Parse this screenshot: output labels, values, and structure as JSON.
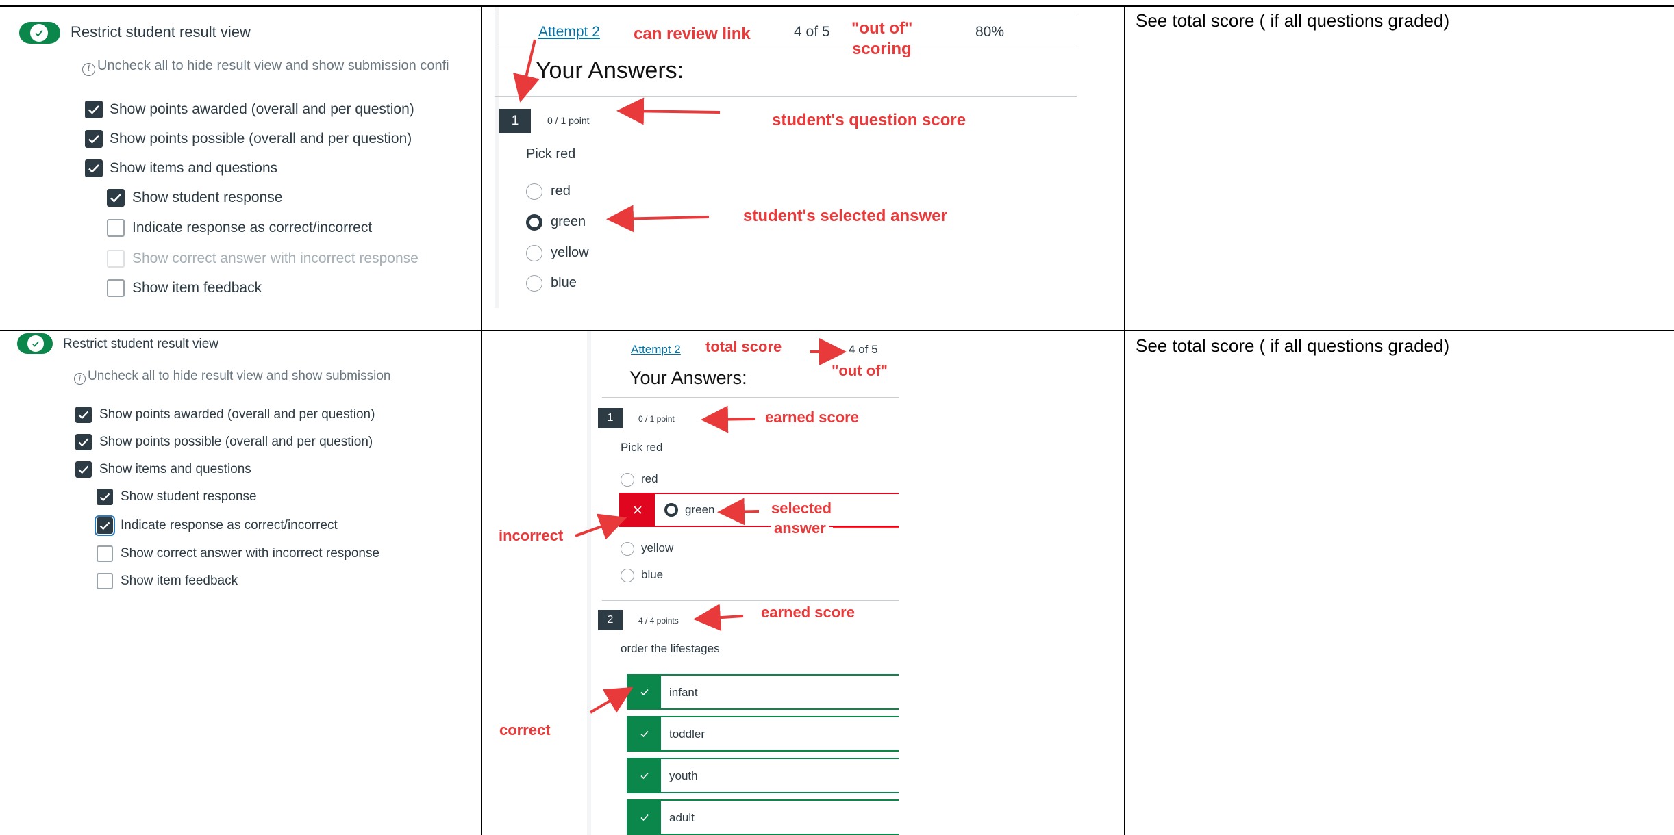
{
  "rows": [
    {
      "settings": {
        "toggle_label": "Restrict student result view",
        "hint": "Uncheck all to hide result view and show submission confi",
        "options": [
          {
            "label": "Show points awarded (overall and per question)",
            "checked": true
          },
          {
            "label": "Show points possible (overall and per question)",
            "checked": true
          },
          {
            "label": "Show items and questions",
            "checked": true
          },
          {
            "label": "Show student response",
            "checked": true
          },
          {
            "label": "Indicate response as correct/incorrect",
            "checked": false
          },
          {
            "label": "Show correct answer with incorrect response",
            "checked": false,
            "disabled": true
          },
          {
            "label": "Show item feedback",
            "checked": false
          }
        ]
      },
      "preview": {
        "attempt_link": "Attempt 2",
        "score": "4 of 5",
        "percent": "80%",
        "heading": "Your Answers:",
        "question": {
          "number": "1",
          "points": "0 / 1 point",
          "prompt": "Pick red",
          "choices": [
            "red",
            "green",
            "yellow",
            "blue"
          ],
          "selected": "green"
        },
        "annotations": {
          "review_link": "can review link",
          "out_of_line1": "\"out of\"",
          "out_of_line2": "scoring",
          "question_score": "student's question score",
          "selected_answer": "student's selected answer"
        }
      },
      "note": "See total score ( if all questions graded)"
    },
    {
      "settings": {
        "toggle_label": "Restrict student result view",
        "hint": "Uncheck all to hide result view and show submission",
        "options": [
          {
            "label": "Show points awarded (overall and per question)",
            "checked": true
          },
          {
            "label": "Show points possible (overall and per question)",
            "checked": true
          },
          {
            "label": "Show items and questions",
            "checked": true
          },
          {
            "label": "Show student response",
            "checked": true
          },
          {
            "label": "Indicate response as correct/incorrect",
            "checked": true,
            "focused": true
          },
          {
            "label": "Show correct answer with incorrect response",
            "checked": false
          },
          {
            "label": "Show item feedback",
            "checked": false
          }
        ]
      },
      "preview": {
        "attempt_link": "Attempt 2",
        "score": "4 of 5",
        "heading": "Your Answers:",
        "question1": {
          "number": "1",
          "points": "0 / 1 point",
          "prompt": "Pick red",
          "choices": [
            "red",
            "green",
            "yellow",
            "blue"
          ],
          "selected": "green",
          "result": "incorrect"
        },
        "question2": {
          "number": "2",
          "points": "4 / 4 points",
          "prompt": "order the lifestages",
          "items": [
            "infant",
            "toddler",
            "youth",
            "adult"
          ]
        },
        "annotations": {
          "total_score": "total score",
          "out_of": "\"out of\"",
          "earned_score_1": "earned score",
          "selected_line1": "selected",
          "selected_line2": "answer",
          "incorrect": "incorrect",
          "earned_score_2": "earned score",
          "correct": "correct"
        }
      },
      "note": "See total score ( if all questions graded)"
    }
  ],
  "colors": {
    "annotation": "#e83a3a",
    "correct": "#0b874b",
    "incorrect": "#e0061f",
    "toggle": "#0b874b",
    "checkbox": "#2d3b45",
    "link": "#0770a3"
  }
}
